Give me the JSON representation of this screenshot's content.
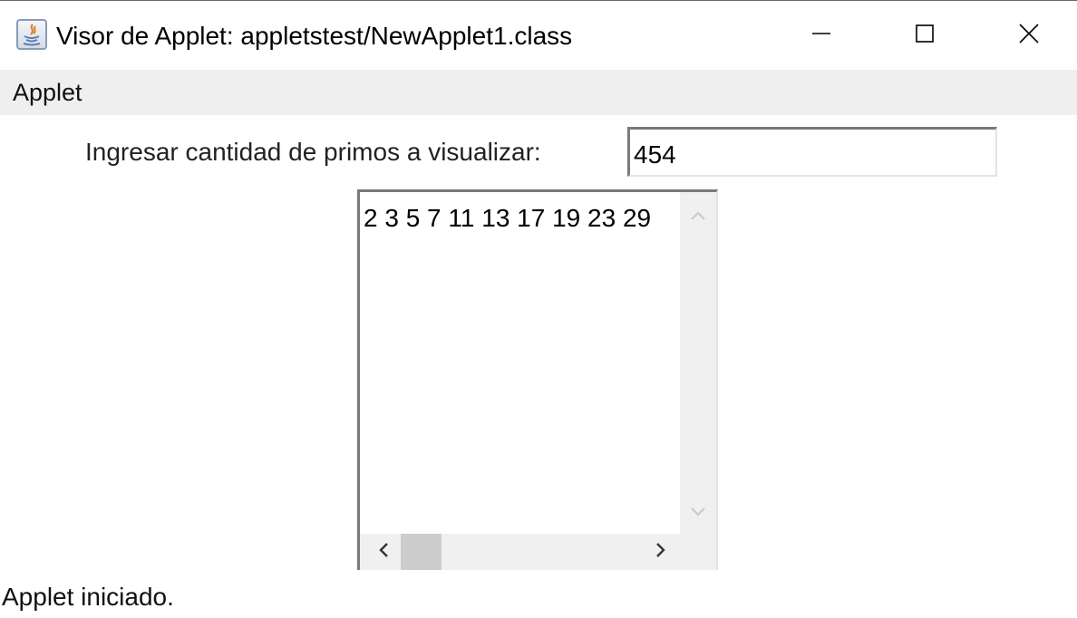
{
  "window": {
    "title": "Visor de Applet: appletstest/NewApplet1.class",
    "icon": "java-applet-icon",
    "controls": {
      "minimize": "minimize-icon",
      "maximize": "maximize-icon",
      "close": "close-icon"
    }
  },
  "menubar": {
    "items": [
      {
        "label": "Applet"
      }
    ]
  },
  "form": {
    "prompt_label": "Ingresar cantidad de primos a visualizar:",
    "count_value": "454"
  },
  "output": {
    "text": "2 3 5 7 11 13 17 19 23 29",
    "scroll_icons": {
      "up": "chevron-up-icon",
      "down": "chevron-down-icon",
      "left": "chevron-left-icon",
      "right": "chevron-right-icon"
    }
  },
  "status": {
    "text": "Applet iniciado."
  },
  "colors": {
    "menubar_bg": "#efefef",
    "scrollbar_track": "#f0f0f0",
    "scrollbar_thumb": "#cdcdcd",
    "field_border_dark": "#7a7a7a"
  }
}
